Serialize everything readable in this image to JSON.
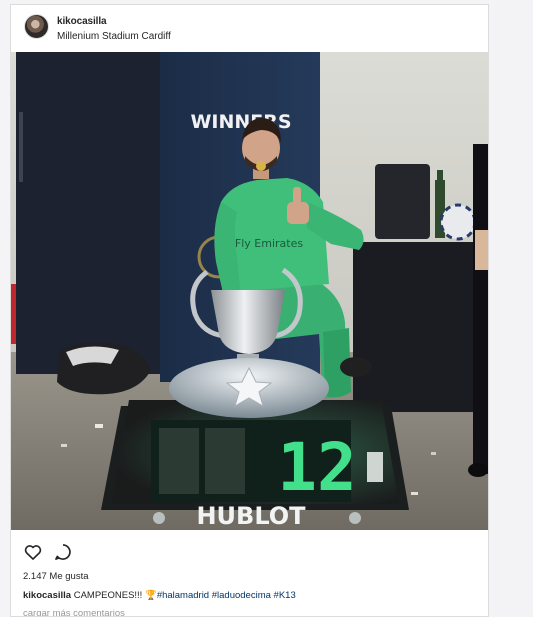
{
  "post": {
    "username": "kikocasilla",
    "location": "Millenium Stadium Cardiff",
    "likes": "2.147 Me gusta",
    "caption_user": "kikocasilla",
    "caption_text": " CAMPEONES!!! ",
    "caption_emoji": "🏆",
    "hashtags": [
      "#halamadrid",
      "#laduodecima",
      "#K13"
    ],
    "load_more": "cargar más comentarios"
  },
  "photo": {
    "banner_text": "WINNERS",
    "brand_text": "HUBLOT",
    "score_text": "12"
  },
  "icons": {
    "like": "heart-icon",
    "comment": "comment-icon"
  },
  "colors": {
    "text": "#262626",
    "hashtag": "#003569",
    "muted": "#999999",
    "jersey": "#3fbf7a",
    "led": "#42e08a"
  }
}
